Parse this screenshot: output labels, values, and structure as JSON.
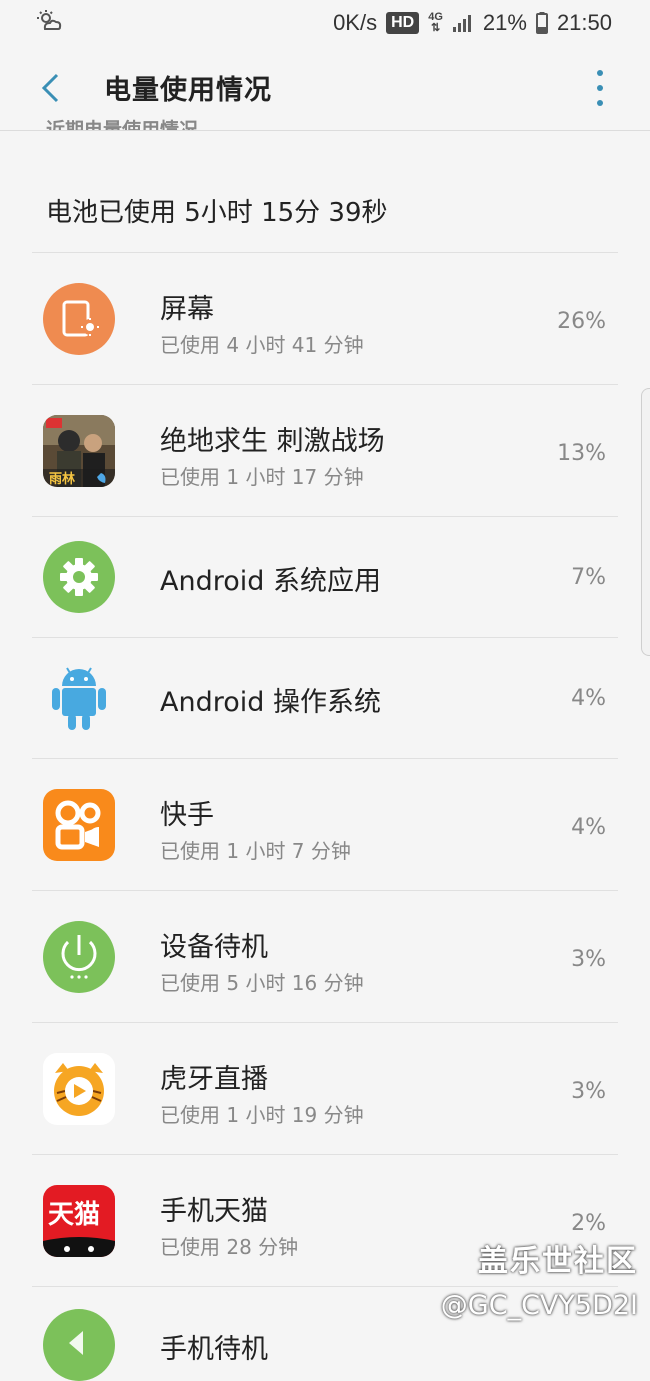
{
  "status_bar": {
    "speed": "0K/s",
    "hd": "HD",
    "network": "4G",
    "battery": "21%",
    "time": "21:50"
  },
  "header": {
    "title": "电量使用情况",
    "back_icon": "back-arrow-icon",
    "more_icon": "more-vert-icon",
    "accent_color": "#3a8fb5"
  },
  "section_header": "近期电量使用情况",
  "summary": "电池已使用 5小时 15分 39秒",
  "items": [
    {
      "name": "屏幕",
      "usage": "已使用 4 小时 41 分钟",
      "percent": "26%",
      "icon": "screen-brightness-icon",
      "color": "#ef8b50"
    },
    {
      "name": "绝地求生 刺激战场",
      "usage": "已使用 1 小时 17 分钟",
      "percent": "13%",
      "icon": "pubg-game-icon",
      "color": "#3a2b1c"
    },
    {
      "name": "Android 系统应用",
      "usage": "",
      "percent": "7%",
      "icon": "gear-icon",
      "color": "#7cc15a"
    },
    {
      "name": "Android 操作系统",
      "usage": "",
      "percent": "4%",
      "icon": "android-robot-icon",
      "color": "#48a9e0"
    },
    {
      "name": "快手",
      "usage": "已使用 1 小时 7 分钟",
      "percent": "4%",
      "icon": "kuaishou-icon",
      "color": "#f98a1b"
    },
    {
      "name": "设备待机",
      "usage": "已使用 5 小时 16 分钟",
      "percent": "3%",
      "icon": "power-icon",
      "color": "#7cc15a"
    },
    {
      "name": "虎牙直播",
      "usage": "已使用 1 小时 19 分钟",
      "percent": "3%",
      "icon": "huya-icon",
      "color": "#f6a623"
    },
    {
      "name": "手机天猫",
      "usage": "已使用 28 分钟",
      "percent": "2%",
      "icon": "tmall-icon",
      "color": "#e31b23"
    },
    {
      "name": "手机待机",
      "usage": "",
      "percent": "",
      "icon": "phone-standby-icon",
      "color": "#7cc15a"
    }
  ],
  "watermark": {
    "line1": "盖乐世社区",
    "line2": "@GC_CVY5D2I"
  }
}
